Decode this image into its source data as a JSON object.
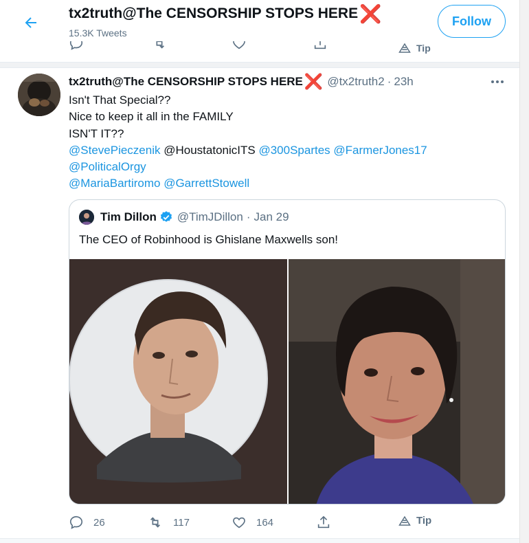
{
  "header": {
    "title": "tx2truth@The CENSORSHIP STOPS HERE",
    "title_mark": "❌",
    "tweet_count": "15.3K Tweets",
    "follow_label": "Follow"
  },
  "previous_tweet_actions": {
    "tip_label": "Tip"
  },
  "tweet": {
    "display_name": "tx2truth@The CENSORSHIP STOPS HERE",
    "name_mark": "❌",
    "handle": "@tx2truth2",
    "separator": "·",
    "time": "23h",
    "lines": {
      "l1": "Isn't That Special??",
      "l2": "Nice to keep it all in the FAMILY",
      "l3": "ISN'T IT??"
    },
    "mentions": {
      "m1": "@StevePieczenik",
      "m2": "@HoustatonicITS",
      "m3": "@300Spartes",
      "m4": "@FarmerJones17",
      "m5": "@PoliticalOrgy",
      "m6": "@MariaBartiromo",
      "m7": "@GarrettStowell"
    },
    "quoted": {
      "name": "Tim Dillon",
      "handle": "@TimJDillon",
      "separator": "·",
      "date": "Jan 29",
      "text": "The CEO of Robinhood is Ghislane Maxwells son!"
    },
    "actions": {
      "replies": "26",
      "retweets": "117",
      "likes": "164",
      "tip_label": "Tip"
    }
  },
  "colors": {
    "accent": "#1da1f2",
    "mention": "#1b95e0",
    "muted": "#5b7083",
    "danger": "#e0245e"
  }
}
